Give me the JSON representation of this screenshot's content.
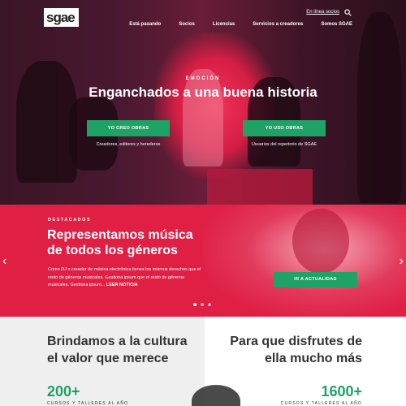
{
  "header": {
    "logo": "sgae",
    "top_link": "En línea socios",
    "nav": [
      "Está pasando",
      "Socios",
      "Licencias",
      "Servicios a creadores",
      "Somos SGAE"
    ]
  },
  "hero": {
    "eyebrow": "EMOCIÓN",
    "title": "Enganchados a una buena historia",
    "buttons": [
      {
        "label": "YO CREO OBRAS",
        "caption": "Creadores, editores y herederos"
      },
      {
        "label": "YO USO OBRAS",
        "caption": "Usuarios del repertorio de SGAE"
      }
    ]
  },
  "featured": {
    "label": "DESTACADOS",
    "title": "Representamos música de todos los géneros",
    "body": "Como DJ o creador de música electrónica tienes los mismos derechos que el resto de géneros musicales. Gestiona ipsum que el resto de géneros musicales. Gestiona ipsum...",
    "read_more": "LEER NOTICIA",
    "cta": "IR A ACTUALIDAD",
    "prev_arrow": "‹",
    "next_arrow": "›"
  },
  "bottom": {
    "left_title": "Brindamos a la cultura el valor que merece",
    "left_stat": "200+",
    "left_stat_label": "CURSOS Y TALLERES AL AÑO",
    "right_title": "Para que disfrutes de ella mucho más",
    "right_stat": "1600+",
    "right_stat_label": "CURSOS Y TALLERES AL AÑO"
  },
  "colors": {
    "brand_red": "#e01f45",
    "green": "#1fa266"
  }
}
